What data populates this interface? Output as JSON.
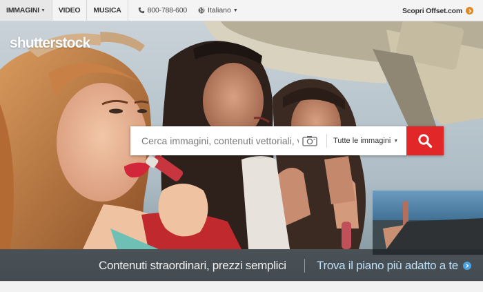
{
  "topbar": {
    "tabs": [
      {
        "label": "IMMAGINI",
        "active": true
      },
      {
        "label": "VIDEO",
        "active": false
      },
      {
        "label": "MUSICA",
        "active": false
      }
    ],
    "phone": "800-788-600",
    "language": "Italiano",
    "offset_link": "Scopri Offset.com"
  },
  "hero": {
    "logo": "shutterstock",
    "search": {
      "placeholder": "Cerca immagini, contenuti vettoriali, v",
      "scope": "Tutte le immagini"
    },
    "promo": {
      "tagline": "Contenuti straordinari, prezzi semplici",
      "link": "Trova il piano più adatto a te"
    }
  },
  "colors": {
    "search_button": "#e22728",
    "offset_accent": "#e1871f",
    "promo_link": "#bfe0f7"
  },
  "icons": [
    "phone-icon",
    "globe-icon",
    "camera-icon",
    "search-icon",
    "arrow-right-icon"
  ]
}
